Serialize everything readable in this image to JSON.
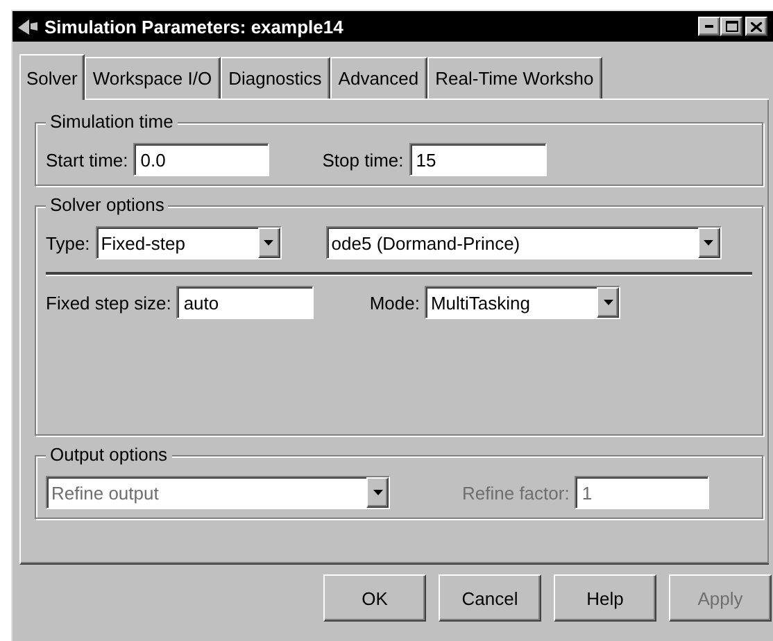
{
  "window": {
    "title": "Simulation Parameters: example14"
  },
  "tabs": [
    {
      "label": "Solver",
      "selected": true
    },
    {
      "label": "Workspace I/O",
      "selected": false
    },
    {
      "label": "Diagnostics",
      "selected": false
    },
    {
      "label": "Advanced",
      "selected": false
    },
    {
      "label": "Real-Time Worksho",
      "selected": false
    }
  ],
  "simulation_time": {
    "title": "Simulation time",
    "start_time": {
      "label": "Start time:",
      "value": "0.0"
    },
    "stop_time": {
      "label": "Stop time:",
      "value": "15"
    }
  },
  "solver_options": {
    "title": "Solver options",
    "type": {
      "label": "Type:",
      "value": "Fixed-step"
    },
    "solver": {
      "value": "ode5 (Dormand-Prince)"
    },
    "fixed_step_size": {
      "label": "Fixed step size:",
      "value": "auto"
    },
    "mode": {
      "label": "Mode:",
      "value": "MultiTasking"
    }
  },
  "output_options": {
    "title": "Output options",
    "refine": {
      "value": "Refine output",
      "disabled": true
    },
    "refine_factor": {
      "label": "Refine factor:",
      "value": "1",
      "disabled": true
    }
  },
  "buttons": [
    {
      "label": "OK",
      "disabled": false
    },
    {
      "label": "Cancel",
      "disabled": false
    },
    {
      "label": "Help",
      "disabled": false
    },
    {
      "label": "Apply",
      "disabled": true
    }
  ]
}
